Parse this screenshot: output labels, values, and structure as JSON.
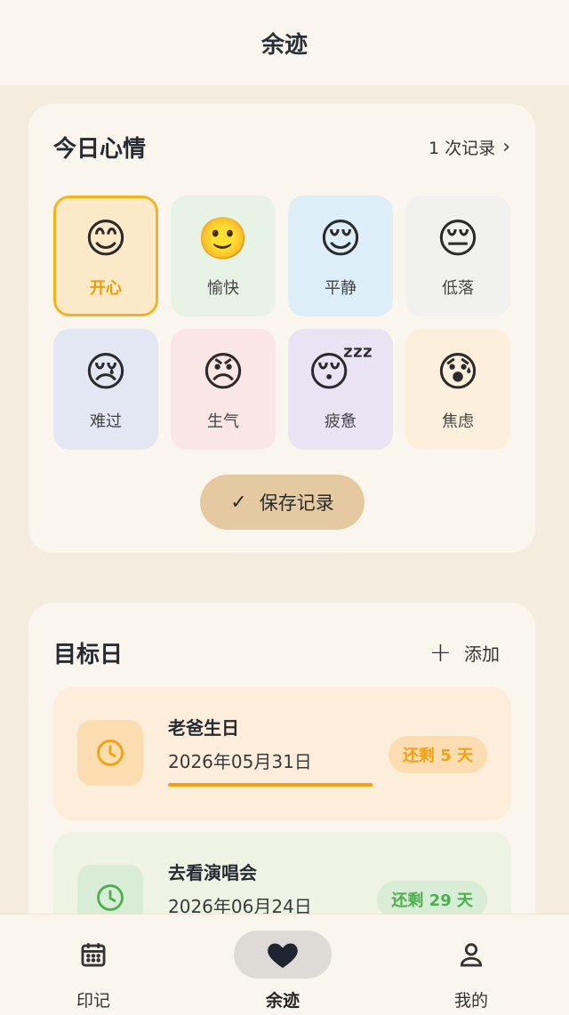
{
  "header": {
    "title": "余迹"
  },
  "mood_card": {
    "title": "今日心情",
    "records_link": "1 次记录",
    "moods": [
      {
        "emoji": "😊",
        "label": "开心",
        "bg": "#FCE9C8",
        "selected": true
      },
      {
        "emoji": "🙂",
        "label": "愉快",
        "bg": "#E7F3E5",
        "selected": false
      },
      {
        "emoji": "😌",
        "label": "平静",
        "bg": "#DDEEF8",
        "selected": false
      },
      {
        "emoji": "😔",
        "label": "低落",
        "bg": "#F1F1EF",
        "selected": false
      },
      {
        "emoji": "😢",
        "label": "难过",
        "bg": "#E3E6F3",
        "selected": false
      },
      {
        "emoji": "😠",
        "label": "生气",
        "bg": "#FBE6E6",
        "selected": false
      },
      {
        "emoji": "😴",
        "label": "疲惫",
        "bg": "#E9E3F3",
        "selected": false
      },
      {
        "emoji": "😰",
        "label": "焦虑",
        "bg": "#FCF0DC",
        "selected": false
      }
    ],
    "save_label": "保存记录"
  },
  "goal_card": {
    "title": "目标日",
    "add_label": "添加",
    "items": [
      {
        "name": "老爸生日",
        "date": "2026年05月31日",
        "badge": "还剩 5 天",
        "accent": "#F5A00F",
        "bg": "#FCEEDA",
        "icon_bg": "#FCDDB1",
        "badge_bg": "#FCDDB1",
        "progress": 0.82
      },
      {
        "name": "去看演唱会",
        "date": "2026年06月24日",
        "badge": "还剩 29 天",
        "accent": "#4CAF50",
        "bg": "#EEF3E4",
        "icon_bg": "#D9ECD5",
        "badge_bg": "#D9ECD5",
        "progress": 0.0
      }
    ]
  },
  "bottom_nav": {
    "items": [
      {
        "label": "印记",
        "icon": "calendar-icon",
        "active": false
      },
      {
        "label": "余迹",
        "icon": "heart-icon",
        "active": true
      },
      {
        "label": "我的",
        "icon": "person-icon",
        "active": false
      }
    ]
  }
}
